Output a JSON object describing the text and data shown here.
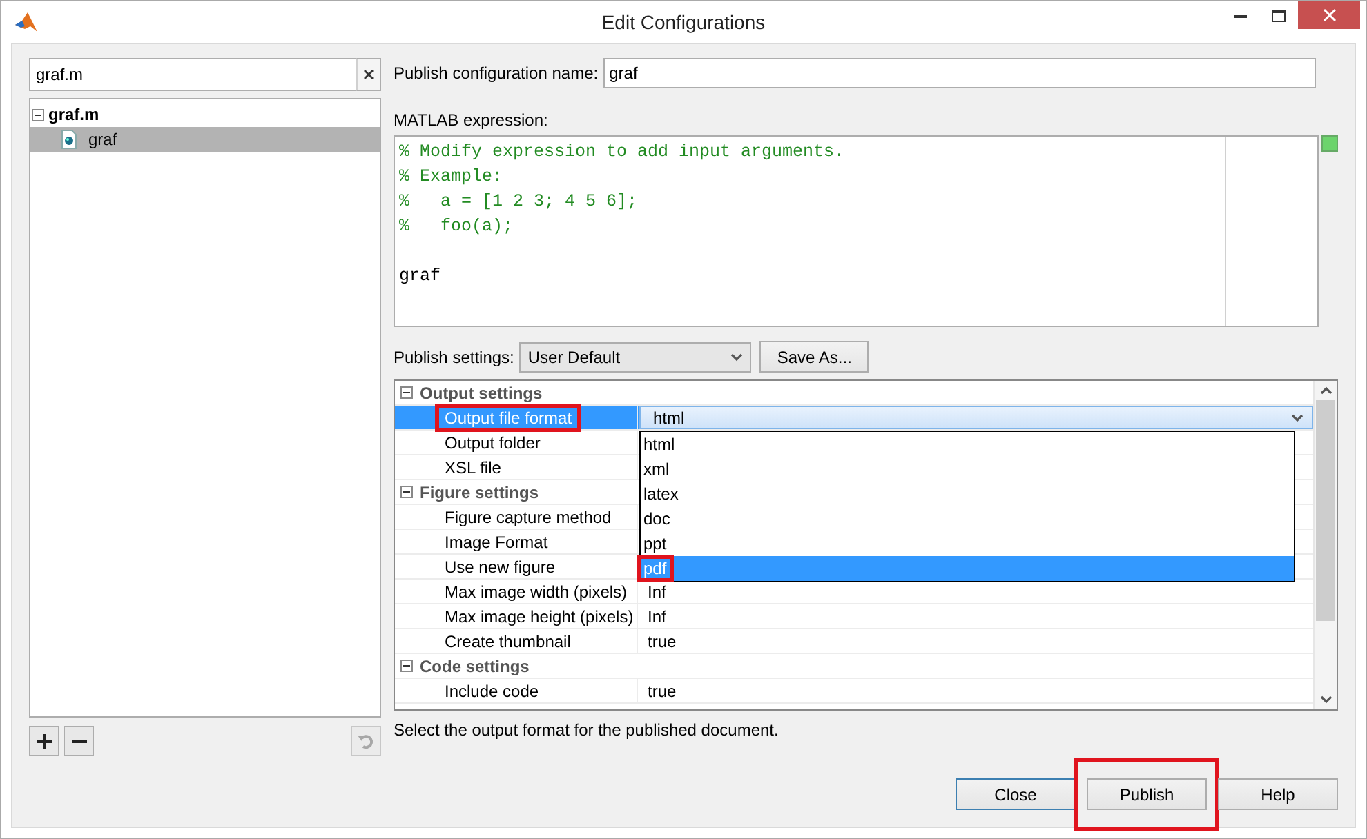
{
  "window": {
    "title": "Edit Configurations"
  },
  "search": {
    "value": "graf.m"
  },
  "tree": [
    {
      "label": "graf.m",
      "expanded": true,
      "children": [
        {
          "label": "graf",
          "selected": true
        }
      ]
    }
  ],
  "config_name": {
    "label": "Publish configuration name:",
    "value": "graf"
  },
  "expression": {
    "label": "MATLAB expression:",
    "lines": [
      {
        "kind": "comment",
        "text": "% Modify expression to add input arguments."
      },
      {
        "kind": "comment",
        "text": "% Example:"
      },
      {
        "kind": "comment",
        "text": "%   a = [1 2 3; 4 5 6];"
      },
      {
        "kind": "comment",
        "text": "%   foo(a);"
      },
      {
        "kind": "blank"
      },
      {
        "kind": "code",
        "text": "graf"
      }
    ]
  },
  "publish_settings": {
    "label": "Publish settings:",
    "value": "User Default",
    "save_button": "Save As..."
  },
  "property_grid": {
    "sections": [
      {
        "title": "Output settings",
        "expanded": true,
        "rows": [
          {
            "label": "Output file format",
            "value": "html",
            "selected": true,
            "highlighted": true,
            "kind": "dropdown"
          },
          {
            "label": "Output folder",
            "selected": false,
            "highlighted": false,
            "kind": "text"
          },
          {
            "label": "XSL file",
            "selected": false,
            "highlighted": false,
            "kind": "text"
          }
        ]
      },
      {
        "title": "Figure settings",
        "expanded": true,
        "rows": [
          {
            "label": "Figure capture method",
            "selected": false,
            "highlighted": false,
            "kind": "text"
          },
          {
            "label": "Image Format",
            "selected": false,
            "highlighted": false,
            "kind": "text"
          },
          {
            "label": "Use new figure",
            "selected": false,
            "highlighted": false,
            "kind": "text"
          },
          {
            "label": "Max image width (pixels)",
            "value": "Inf",
            "selected": false,
            "highlighted": false,
            "kind": "text"
          },
          {
            "label": "Max image height (pixels)",
            "value": "Inf",
            "selected": false,
            "highlighted": false,
            "kind": "text"
          },
          {
            "label": "Create thumbnail",
            "value": "true",
            "selected": false,
            "highlighted": false,
            "kind": "text"
          }
        ]
      },
      {
        "title": "Code settings",
        "expanded": true,
        "rows": [
          {
            "label": "Include code",
            "value": "true",
            "selected": false,
            "highlighted": false,
            "kind": "text"
          }
        ]
      }
    ],
    "dropdown_options": [
      {
        "label": "html",
        "selected": false,
        "highlighted": false
      },
      {
        "label": "xml",
        "selected": false,
        "highlighted": false
      },
      {
        "label": "latex",
        "selected": false,
        "highlighted": false
      },
      {
        "label": "doc",
        "selected": false,
        "highlighted": false
      },
      {
        "label": "ppt",
        "selected": false,
        "highlighted": false
      },
      {
        "label": "pdf",
        "selected": true,
        "highlighted": true
      }
    ]
  },
  "description": "Select the output format for the published document.",
  "buttons": [
    {
      "label": "Close",
      "highlighted": false,
      "focused": true
    },
    {
      "label": "Publish",
      "highlighted": true,
      "focused": false
    },
    {
      "label": "Help",
      "highlighted": false,
      "focused": false
    }
  ]
}
